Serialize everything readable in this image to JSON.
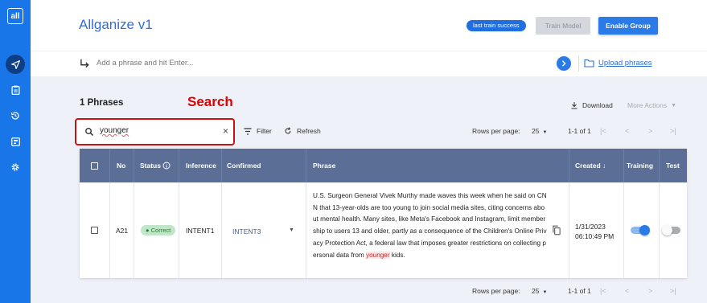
{
  "app": {
    "logo": "all",
    "title": "Allganize v1",
    "train_badge": "last train success",
    "train_model_label": "Train Model",
    "enable_group_label": "Enable Group"
  },
  "sidebar": {
    "items": [
      {
        "icon": "send-icon",
        "active": true
      },
      {
        "icon": "clipboard-icon",
        "active": false
      },
      {
        "icon": "history-icon",
        "active": false
      },
      {
        "icon": "dashboard-icon",
        "active": false
      },
      {
        "icon": "settings-icon",
        "active": false
      }
    ]
  },
  "add_phrase": {
    "placeholder": "Add a phrase and hit Enter...",
    "upload_label": "Upload phrases"
  },
  "annotation": "Search",
  "toolbar": {
    "count_label": "1 Phrases",
    "download_label": "Download",
    "more_actions_label": "More Actions",
    "search_value": "younger",
    "search_clear": "×",
    "filter_label": "Filter",
    "refresh_label": "Refresh"
  },
  "pagination": {
    "rows_per_page_label": "Rows per page:",
    "rows_per_page_value": "25",
    "range": "1-1 of 1"
  },
  "table": {
    "headers": {
      "no": "No",
      "status": "Status",
      "inference": "Inference",
      "confirmed": "Confirmed",
      "phrase": "Phrase",
      "created": "Created",
      "training": "Training",
      "test": "Test"
    },
    "rows": [
      {
        "no": "A21",
        "status": "Correct",
        "inference": "INTENT1",
        "confirmed": "INTENT3",
        "phrase_before": "U.S. Surgeon General Vivek Murthy made waves this week when he said on CNN that 13-year-olds are too young to join social media sites, citing concerns about mental health. Many sites, like Meta's Facebook and Instagram, limit membership to users 13 and older, partly as a consequence of the Children's Online Privacy Protection Act, a federal law that imposes greater restrictions on collecting personal data from ",
        "phrase_highlight": "younger",
        "phrase_after": " kids.",
        "created_date": "1/31/2023",
        "created_time": "06:10:49 PM",
        "training": true,
        "test": false
      }
    ]
  },
  "colors": {
    "brand": "#1976e8",
    "header_row": "#5b6e95",
    "status_correct_bg": "#bfe6c6",
    "annotation": "#e00000"
  }
}
